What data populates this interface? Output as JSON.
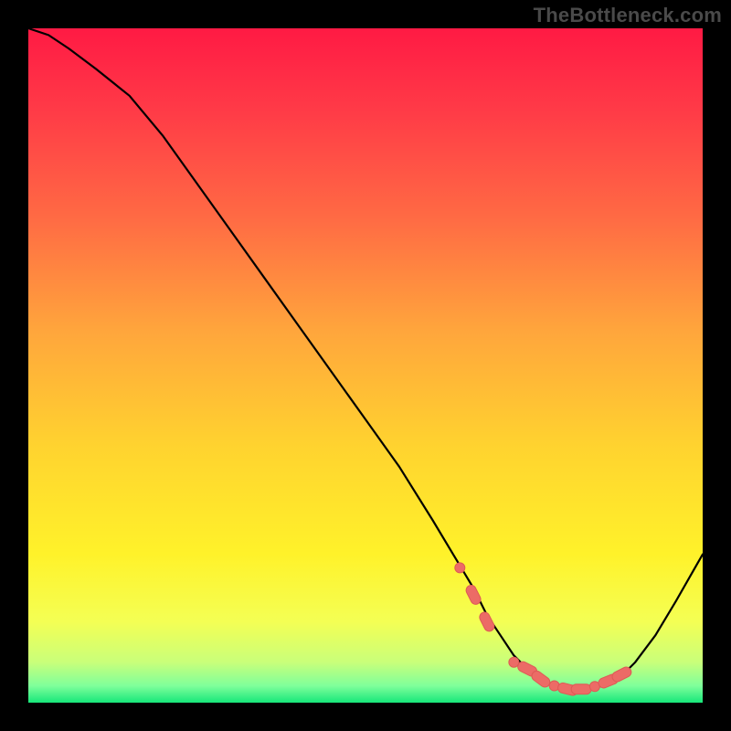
{
  "attribution": "TheBottleneck.com",
  "colors": {
    "marker_fill": "#ec6b66",
    "marker_stroke": "#de5a55",
    "curve": "#000000"
  },
  "gradient_stops": [
    {
      "offset": 0.0,
      "color": "#ff1a44"
    },
    {
      "offset": 0.12,
      "color": "#ff3a47"
    },
    {
      "offset": 0.28,
      "color": "#ff6a44"
    },
    {
      "offset": 0.45,
      "color": "#ffa63c"
    },
    {
      "offset": 0.62,
      "color": "#ffd32f"
    },
    {
      "offset": 0.78,
      "color": "#fff22a"
    },
    {
      "offset": 0.88,
      "color": "#f4ff54"
    },
    {
      "offset": 0.94,
      "color": "#c9ff7a"
    },
    {
      "offset": 0.975,
      "color": "#7fff9b"
    },
    {
      "offset": 1.0,
      "color": "#17e77a"
    }
  ],
  "chart_data": {
    "type": "line",
    "title": "",
    "xlabel": "",
    "ylabel": "",
    "xlim": [
      0,
      100
    ],
    "ylim": [
      0,
      100
    ],
    "x": [
      0,
      3,
      6,
      10,
      15,
      20,
      25,
      30,
      35,
      40,
      45,
      50,
      55,
      60,
      63,
      66,
      68,
      70,
      72,
      74,
      76,
      78,
      80,
      82,
      84,
      86,
      88,
      90,
      93,
      96,
      100
    ],
    "y": [
      100,
      99,
      97,
      94,
      90,
      84,
      77,
      70,
      63,
      56,
      49,
      42,
      35,
      27,
      22,
      17,
      13,
      10,
      7,
      5,
      3.5,
      2.5,
      2.0,
      2.0,
      2.2,
      2.8,
      4,
      6,
      10,
      15,
      22
    ],
    "markers_x": [
      64,
      66,
      68,
      72,
      74,
      76,
      78,
      80,
      82,
      84,
      86,
      88
    ],
    "markers_y": [
      20,
      16,
      12,
      6,
      5,
      3.5,
      2.5,
      2.0,
      2.0,
      2.4,
      3.2,
      4.2
    ]
  }
}
